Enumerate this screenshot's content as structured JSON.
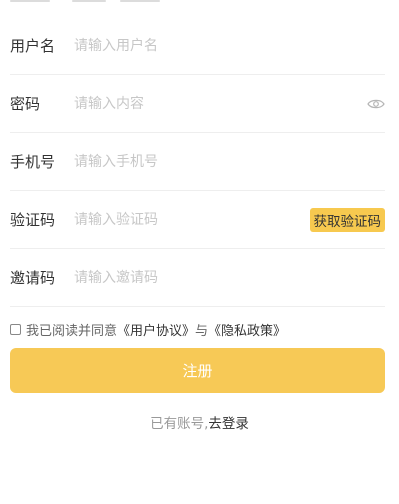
{
  "form": {
    "username": {
      "label": "用户名",
      "placeholder": "请输入用户名"
    },
    "password": {
      "label": "密码",
      "placeholder": "请输入内容",
      "toggle_icon": "eye-icon"
    },
    "phone": {
      "label": "手机号",
      "placeholder": "请输入手机号"
    },
    "code": {
      "label": "验证码",
      "placeholder": "请输入验证码",
      "button": "获取验证码"
    },
    "invite": {
      "label": "邀请码",
      "placeholder": "请输入邀请码"
    }
  },
  "agreement": {
    "prefix": "我已阅读并同意",
    "user_agreement": "《用户协议》",
    "and": "与",
    "privacy_policy": "《隐私政策》",
    "checked": false
  },
  "register_button": "注册",
  "login_tip": {
    "prefix": "已有账号,",
    "link": "去登录"
  },
  "colors": {
    "accent": "#f7c956",
    "placeholder": "#c7c7c7",
    "divider": "#eeeeee"
  }
}
